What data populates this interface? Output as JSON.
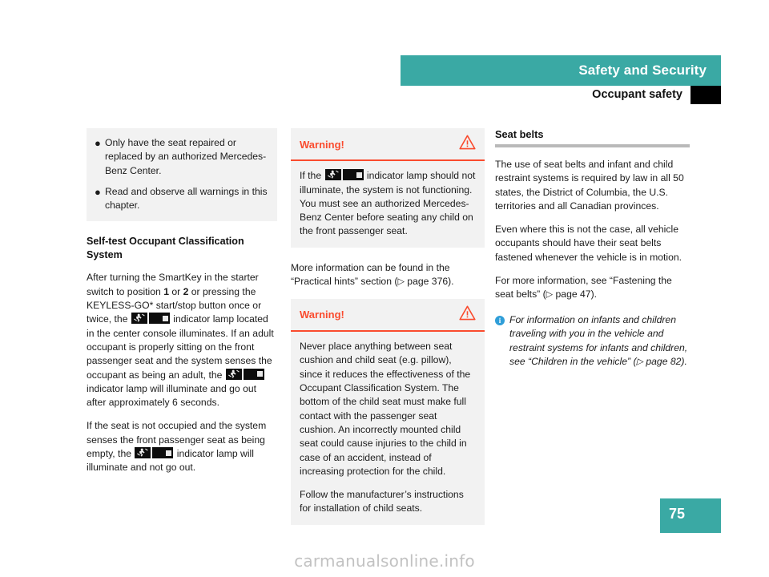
{
  "header": {
    "chapter_title": "Safety and Security",
    "section_title": "Occupant safety"
  },
  "colors": {
    "teal": "#3aa9a4",
    "warning_red": "#fa4b2e",
    "info_blue": "#2f9ed8",
    "box_grey": "#f2f2f2",
    "rule_grey": "#b9b9b9"
  },
  "left_column": {
    "bullets": [
      "Only have the seat repaired or replaced by an authorized Mercedes-Benz Center.",
      "Read and observe all warnings in this chapter."
    ],
    "heading": "Self-test Occupant Classification System",
    "para1_a": "After turning the SmartKey in the starter switch to position ",
    "para1_pos1": "1",
    "para1_b": " or ",
    "para1_pos2": "2",
    "para1_c": " or pressing the KEYLESS-GO* start/stop button once or twice, the ",
    "para1_d": " indicator lamp located in the center console illuminates. If an adult occupant is properly sitting on the front passenger seat and the system senses the occupant as being an adult, the ",
    "para1_e": " indicator lamp will illuminate and go out after approximately 6 seconds.",
    "para2_a": "If the seat is not occupied and the system senses the front passenger seat as being empty, the ",
    "para2_b": " indicator lamp will illuminate and not go out."
  },
  "middle_column": {
    "warning1": {
      "title": "Warning!",
      "text_a": "If the ",
      "text_b": " indicator lamp should not illuminate, the system is not functioning. You must see an authorized Mercedes-Benz Center before seating any child on the front passenger seat."
    },
    "more_info_a": "More information can be found in the “Practical hints” section (",
    "more_info_arrow": "▷",
    "more_info_b": " page 376).",
    "warning2": {
      "title": "Warning!",
      "para1": "Never place anything between seat cushion and child seat (e.g. pillow), since it reduces the effectiveness of the Occupant Classification System. The bottom of the child seat must make full contact with the passenger seat cushion. An incorrectly mounted child seat could cause injuries to the child in case of an accident, instead of increasing protection for the child.",
      "para2": "Follow the manufacturer’s instructions for installation of child seats."
    }
  },
  "right_column": {
    "heading": "Seat belts",
    "para1": "The use of seat belts and infant and child restraint systems is required by law in all 50 states, the District of Columbia, the U.S. territories and all Canadian provinces.",
    "para2": "Even where this is not the case, all vehicle occupants should have their seat belts fastened whenever the vehicle is in motion.",
    "para3_a": "For more information, see “Fastening the seat belts” (",
    "para3_arrow": "▷",
    "para3_b": " page 47).",
    "note_a": "For information on infants and children traveling with you in the vehicle and restraint systems for infants and children, see “Children in the vehicle” (",
    "note_arrow": "▷",
    "note_b": " page 82).",
    "info_icon_label": "i"
  },
  "footer": {
    "page_number": "75",
    "watermark": "carmanualsonline.info"
  },
  "icons": {
    "airbag_symbol": "passenger-airbag-figure",
    "pass_airbag_off_symbol": "PASS AIR BAG OFF",
    "warning_triangle": "warning-triangle"
  }
}
